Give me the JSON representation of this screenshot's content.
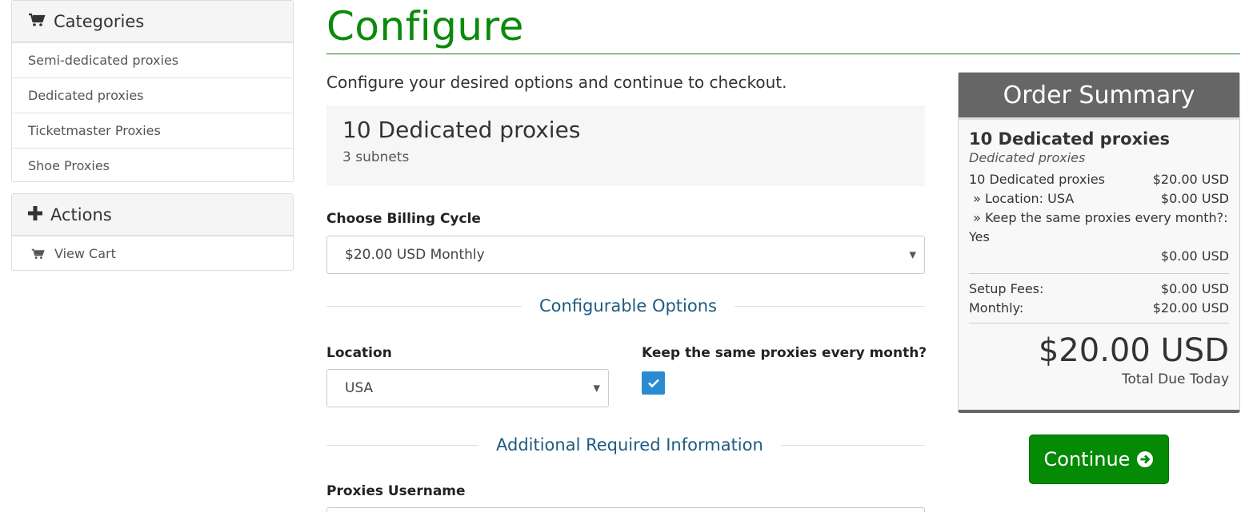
{
  "sidebar": {
    "categories": {
      "title": "Categories",
      "items": [
        {
          "label": "Semi-dedicated proxies"
        },
        {
          "label": "Dedicated proxies"
        },
        {
          "label": "Ticketmaster Proxies"
        },
        {
          "label": "Shoe Proxies"
        }
      ]
    },
    "actions": {
      "title": "Actions",
      "items": [
        {
          "label": "View Cart",
          "icon": "cart-icon"
        }
      ]
    }
  },
  "main": {
    "title": "Configure",
    "intro": "Configure your desired options and continue to checkout.",
    "product": {
      "name": "10 Dedicated proxies",
      "subtitle": "3 subnets"
    },
    "billing": {
      "label": "Choose Billing Cycle",
      "value": "$20.00 USD Monthly"
    },
    "configurable_heading": "Configurable Options",
    "location": {
      "label": "Location",
      "value": "USA"
    },
    "keep_same": {
      "label": "Keep the same proxies every month?",
      "checked": true
    },
    "additional_heading": "Additional Required Information",
    "username": {
      "label": "Proxies Username"
    }
  },
  "summary": {
    "title": "Order Summary",
    "product_name": "10 Dedicated proxies",
    "product_group": "Dedicated proxies",
    "lines": [
      {
        "label": "10 Dedicated proxies",
        "value": "$20.00 USD"
      },
      {
        "label": " » Location: USA",
        "value": "$0.00 USD"
      }
    ],
    "keep_line": " » Keep the same proxies every month?: Yes",
    "keep_value": "$0.00 USD",
    "setup_label": "Setup Fees:",
    "setup_value": "$0.00 USD",
    "monthly_label": "Monthly:",
    "monthly_value": "$20.00 USD",
    "total": "$20.00 USD",
    "total_label": "Total Due Today"
  },
  "continue_button": {
    "label": "Continue"
  },
  "colors": {
    "brand_green": "#0a8a0a",
    "section_blue": "#1d5b80",
    "checkbox_blue": "#2a8bd1",
    "summary_header": "#666666"
  }
}
